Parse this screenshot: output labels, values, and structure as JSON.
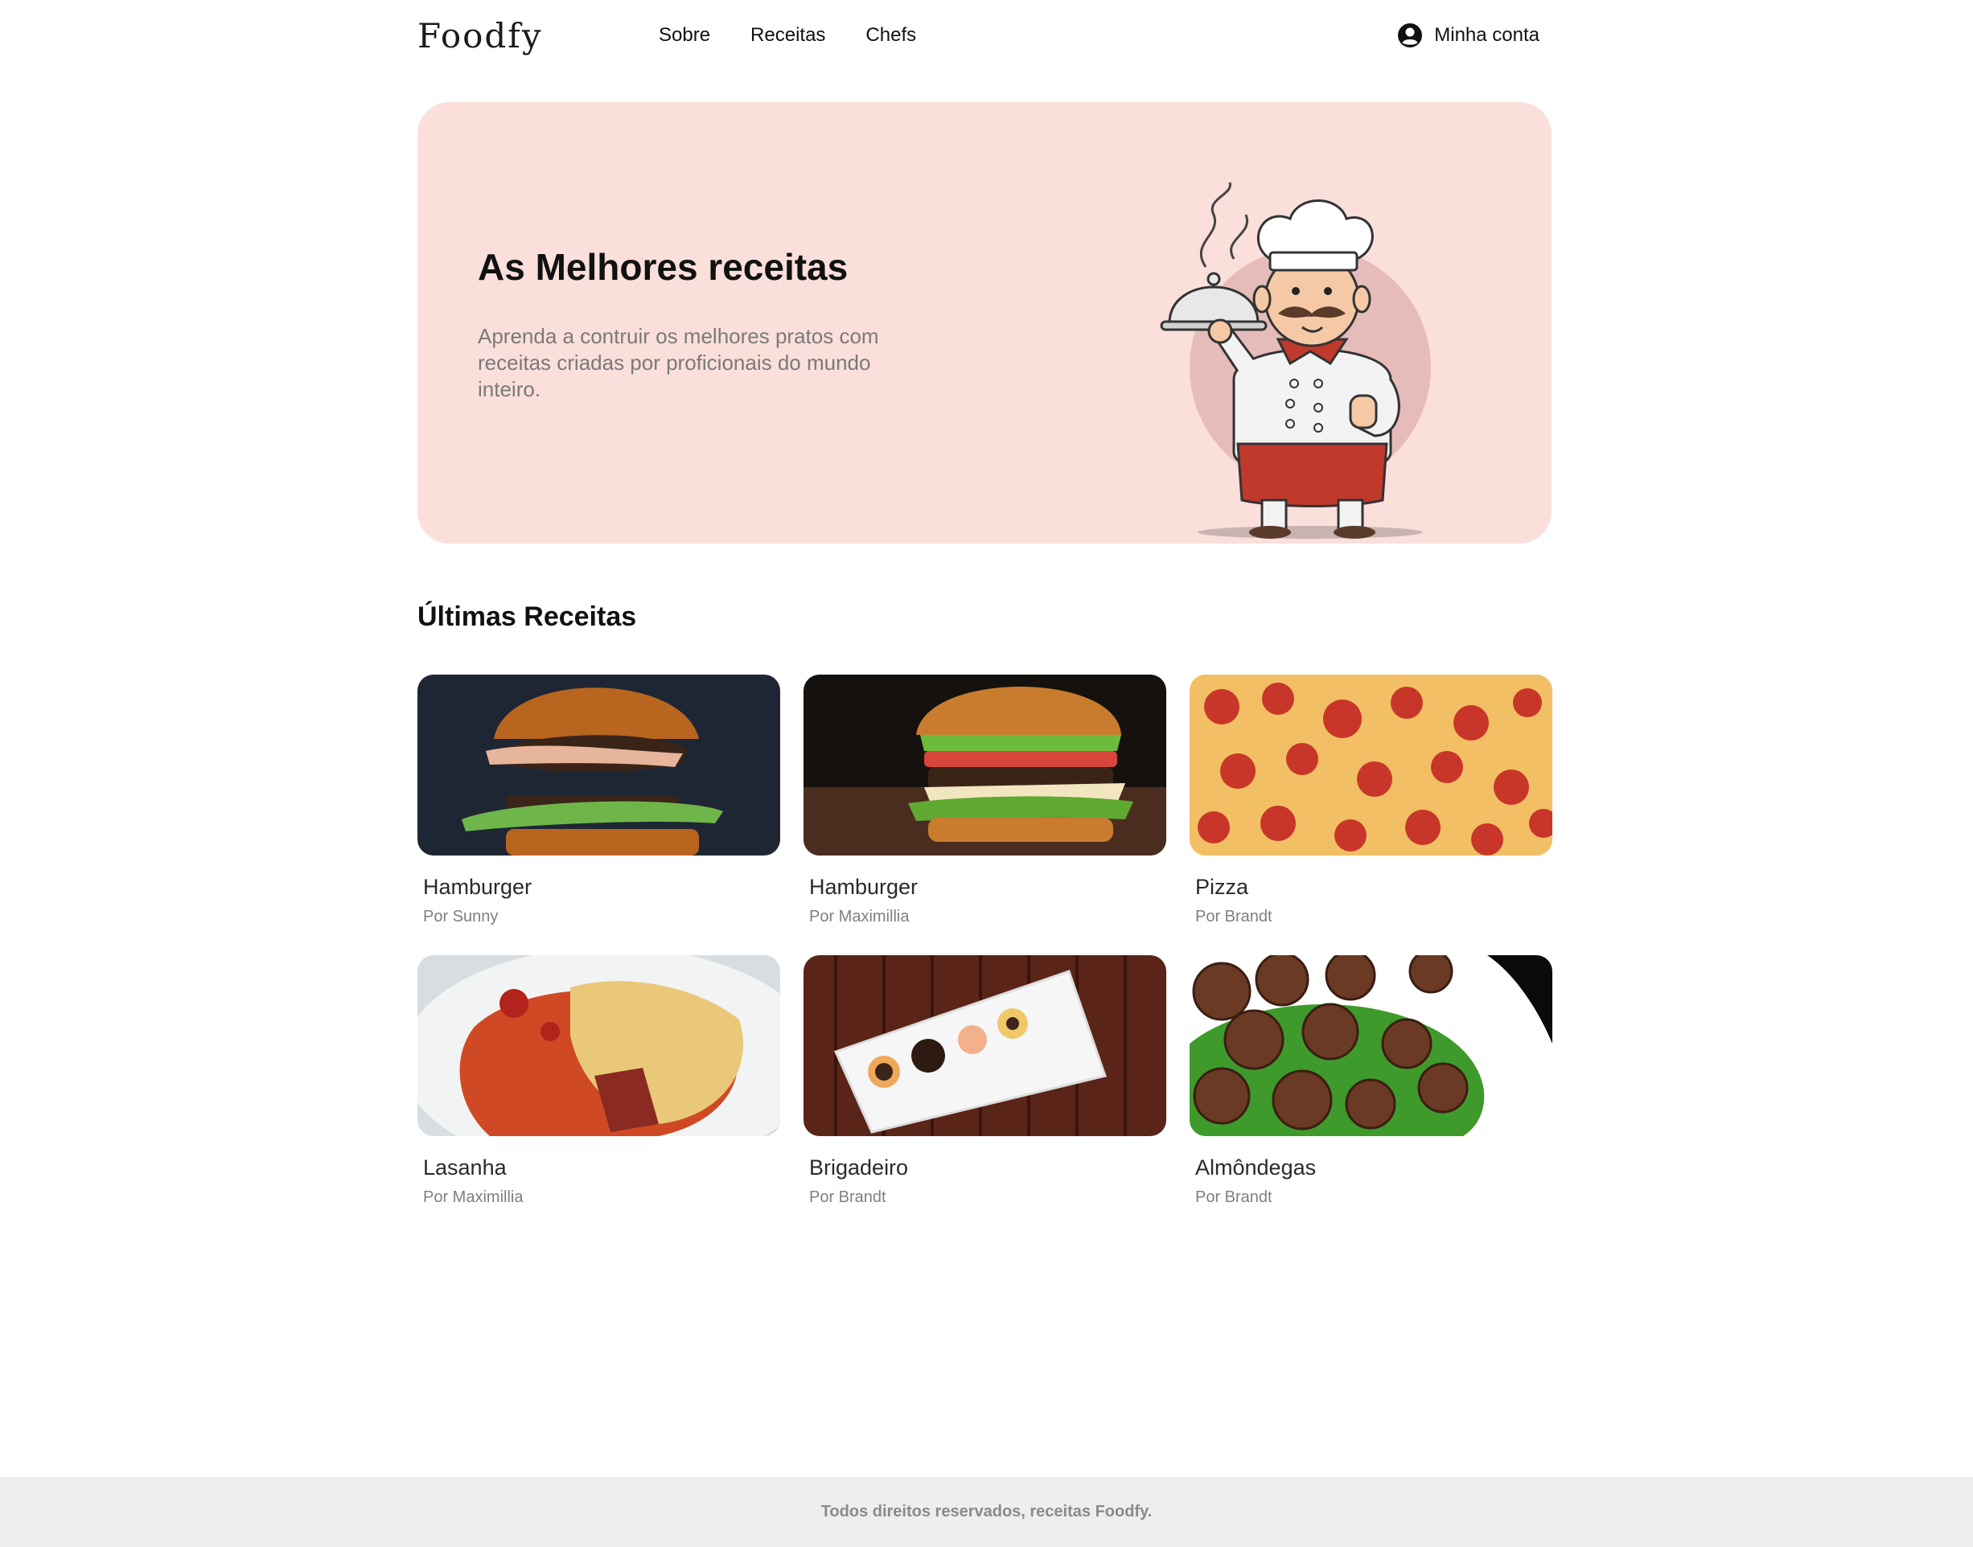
{
  "header": {
    "logo": "Foodfy",
    "nav": [
      {
        "label": "Sobre"
      },
      {
        "label": "Receitas"
      },
      {
        "label": "Chefs"
      }
    ],
    "account_label": "Minha conta",
    "account_icon": "user-circle-icon"
  },
  "hero": {
    "title": "As Melhores receitas",
    "text": "Aprenda a contruir os melhores pratos com receitas criadas por proficionais do mundo inteiro.",
    "background": "#fbdfdb"
  },
  "section": {
    "title": "Últimas Receitas"
  },
  "recipes": [
    {
      "title": "Hamburger",
      "author": "Por Sunny"
    },
    {
      "title": "Hamburger",
      "author": "Por Maximillia"
    },
    {
      "title": "Pizza",
      "author": "Por Brandt"
    },
    {
      "title": "Lasanha",
      "author": "Por Maximillia"
    },
    {
      "title": "Brigadeiro",
      "author": "Por Brandt"
    },
    {
      "title": "Almôndegas",
      "author": "Por Brandt"
    }
  ],
  "footer": {
    "text": "Todos direitos reservados, receitas Foodfy."
  }
}
